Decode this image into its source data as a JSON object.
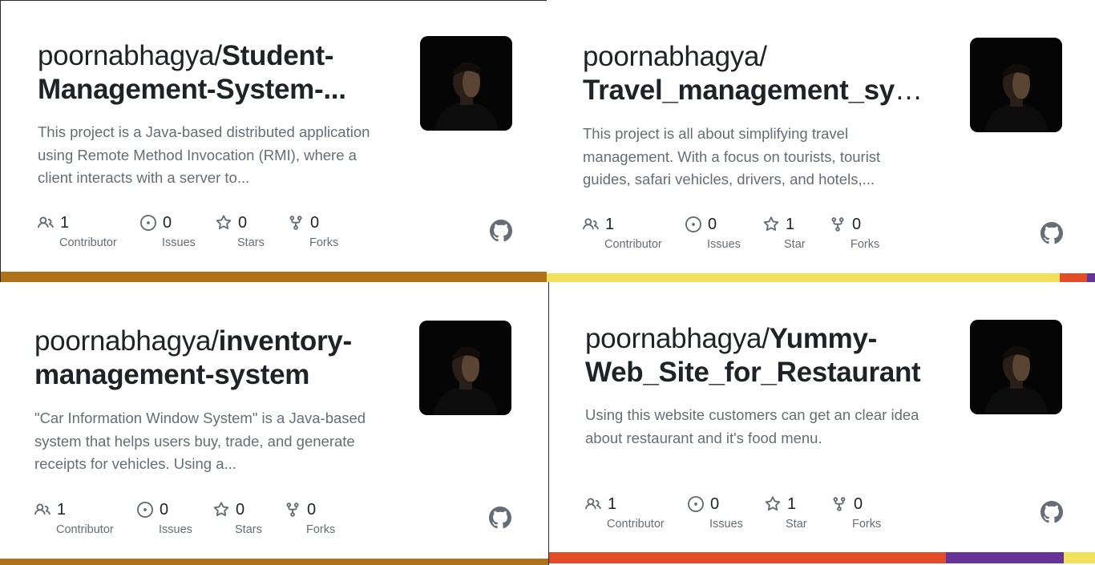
{
  "cards": [
    {
      "owner": "poornabhagya/",
      "repo_line1": "Student-",
      "repo_line2": "Management-System-...",
      "description": "This project is a Java-based distributed application using Remote Method Invocation (RMI), where a client interacts with a server to...",
      "stats": {
        "contributors": "1",
        "contributors_label": "Contributor",
        "issues": "0",
        "issues_label": "Issues",
        "stars": "0",
        "stars_label": "Stars",
        "forks": "0",
        "forks_label": "Forks"
      },
      "language_colors": [
        "#b07219"
      ]
    },
    {
      "owner": "poornabhagya/",
      "repo_line1": "",
      "repo_line2": "Travel_management_syst...",
      "description": "This project is all about simplifying travel management. With a focus on tourists, tourist guides, safari vehicles, drivers, and hotels,...",
      "stats": {
        "contributors": "1",
        "contributors_label": "Contributor",
        "issues": "0",
        "issues_label": "Issues",
        "stars": "1",
        "stars_label": "Star",
        "forks": "0",
        "forks_label": "Forks"
      },
      "language_colors": [
        "#f1e05a",
        "#e34c26",
        "#663399"
      ]
    },
    {
      "owner": "poornabhagya/",
      "repo_line1": "inventory-",
      "repo_line2": "management-system",
      "description": "\"Car Information Window System\" is a Java-based system that helps users buy, trade, and generate receipts for vehicles. Using a...",
      "stats": {
        "contributors": "1",
        "contributors_label": "Contributor",
        "issues": "0",
        "issues_label": "Issues",
        "stars": "0",
        "stars_label": "Stars",
        "forks": "0",
        "forks_label": "Forks"
      },
      "language_colors": [
        "#b07219"
      ]
    },
    {
      "owner": "poornabhagya/",
      "repo_line1": "Yummy-",
      "repo_line2": "Web_Site_for_Restaurant",
      "description": "Using this website customers can get an clear idea about restaurant and it's food menu.",
      "stats": {
        "contributors": "1",
        "contributors_label": "Contributor",
        "issues": "0",
        "issues_label": "Issues",
        "stars": "1",
        "stars_label": "Star",
        "forks": "0",
        "forks_label": "Forks"
      },
      "language_colors": [
        "#e34c26",
        "#663399",
        "#f1e05a"
      ]
    }
  ],
  "icons": {
    "contributors": "people-icon",
    "issues": "issue-opened-icon",
    "stars": "star-icon",
    "forks": "repo-forked-icon",
    "brand": "github-mark-icon"
  },
  "colors": {
    "title": "#1f2328",
    "muted": "#656d76",
    "java": "#b07219",
    "javascript": "#f1e05a",
    "html": "#e34c26",
    "css": "#663399"
  }
}
